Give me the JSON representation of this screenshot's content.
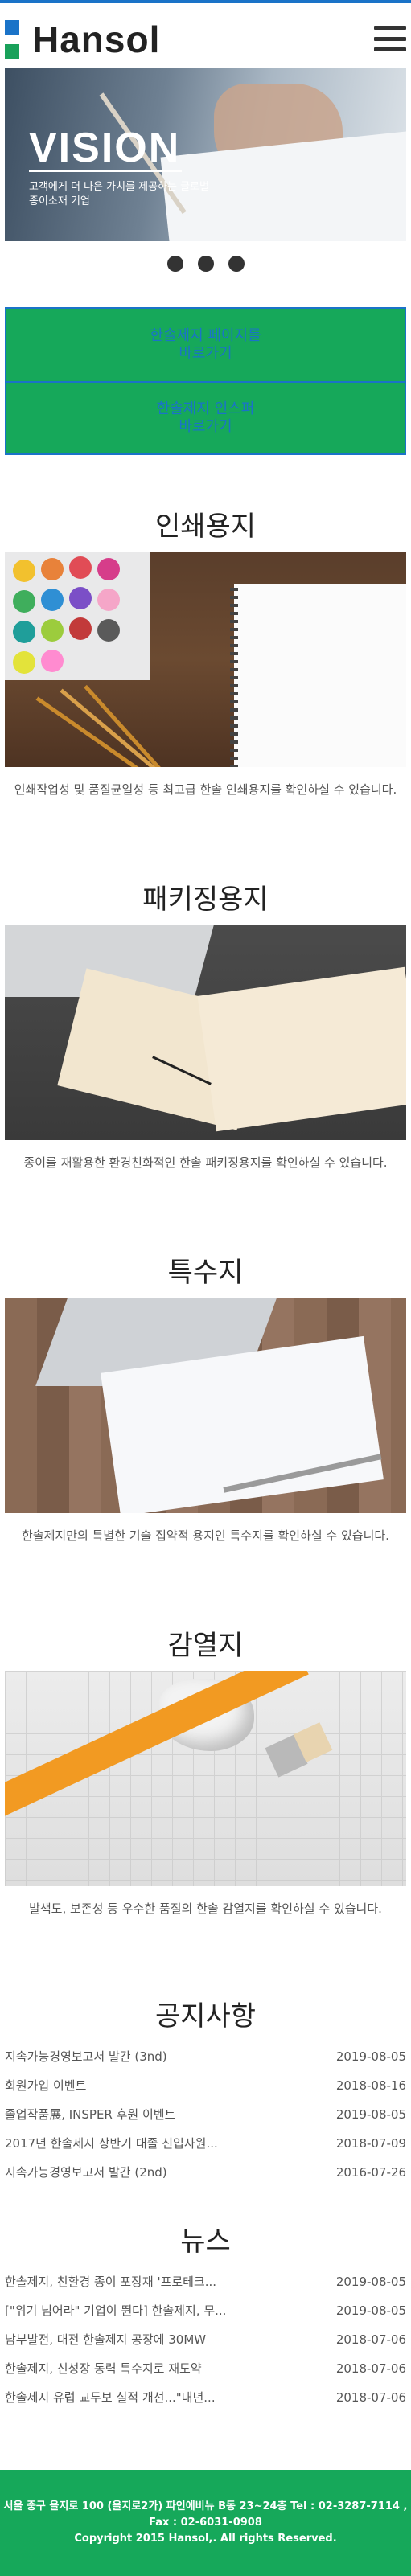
{
  "header": {
    "logo_text": "Hansol",
    "menu_icon": "hamburger-menu-icon"
  },
  "hero": {
    "title": "VISION",
    "subtitle": "고객에게 더 나은 가치를 제공하는 글로벌 종이소재 기업"
  },
  "buttons": {
    "paper_homepage": "한솔제지 페이지를\n바로가기",
    "inside_link": "한솔제지 인스퍼\n바로가기"
  },
  "products": [
    {
      "title": "인쇄용지",
      "desc": "인쇄작업성 및 품질균일성 등 최고급 한솔 인쇄용지를 확인하실 수 있습니다."
    },
    {
      "title": "패키징용지",
      "desc": "종이를 재활용한 환경친화적인 한솔 패키징용지를 확인하실 수 있습니다."
    },
    {
      "title": "특수지",
      "desc": "한솔제지만의 특별한 기술 집약적 용지인 특수지를 확인하실 수 있습니다."
    },
    {
      "title": "감열지",
      "desc": "발색도, 보존성 등 우수한 품질의 한솔 감열지를 확인하실 수 있습니다."
    }
  ],
  "notice": {
    "title": "공지사항",
    "items": [
      {
        "text": "지속가능경영보고서 발간 (3nd)",
        "date": "2019-08-05"
      },
      {
        "text": "회원가입 이벤트",
        "date": "2018-08-16"
      },
      {
        "text": "졸업작품展, INSPER 후원 이벤트",
        "date": "2019-08-05"
      },
      {
        "text": "2017년 한솔제지 상반기 대졸 신입사원...",
        "date": "2018-07-09"
      },
      {
        "text": "지속가능경영보고서 발간 (2nd)",
        "date": "2016-07-26"
      }
    ]
  },
  "news": {
    "title": "뉴스",
    "items": [
      {
        "text": "한솔제지, 친환경 종이 포장재 '프로테크...",
        "date": "2019-08-05"
      },
      {
        "text": "[\"위기 넘어라\" 기업이 뛴다] 한솔제지, 무...",
        "date": "2019-08-05"
      },
      {
        "text": "남부발전, 대전 한솔제지 공장에 30MW",
        "date": "2018-07-06"
      },
      {
        "text": "한솔제지, 신성장 동력 특수지로 재도약",
        "date": "2018-07-06"
      },
      {
        "text": "한솔제지 유럽 교두보 실적 개선...\"내년...",
        "date": "2018-07-06"
      }
    ]
  },
  "footer": {
    "address": "서울 중구 을지로 100 (을지로2가) 파인에비뉴 B동 23~24층 Tel : 02-3287-7114 ,",
    "fax": "Fax : 02-6031-0908",
    "copyright": "Copyright 2015 Hansol,. All rights Reserved."
  },
  "colors": {
    "brand_blue": "#1a73c8",
    "brand_green": "#16a85a"
  }
}
